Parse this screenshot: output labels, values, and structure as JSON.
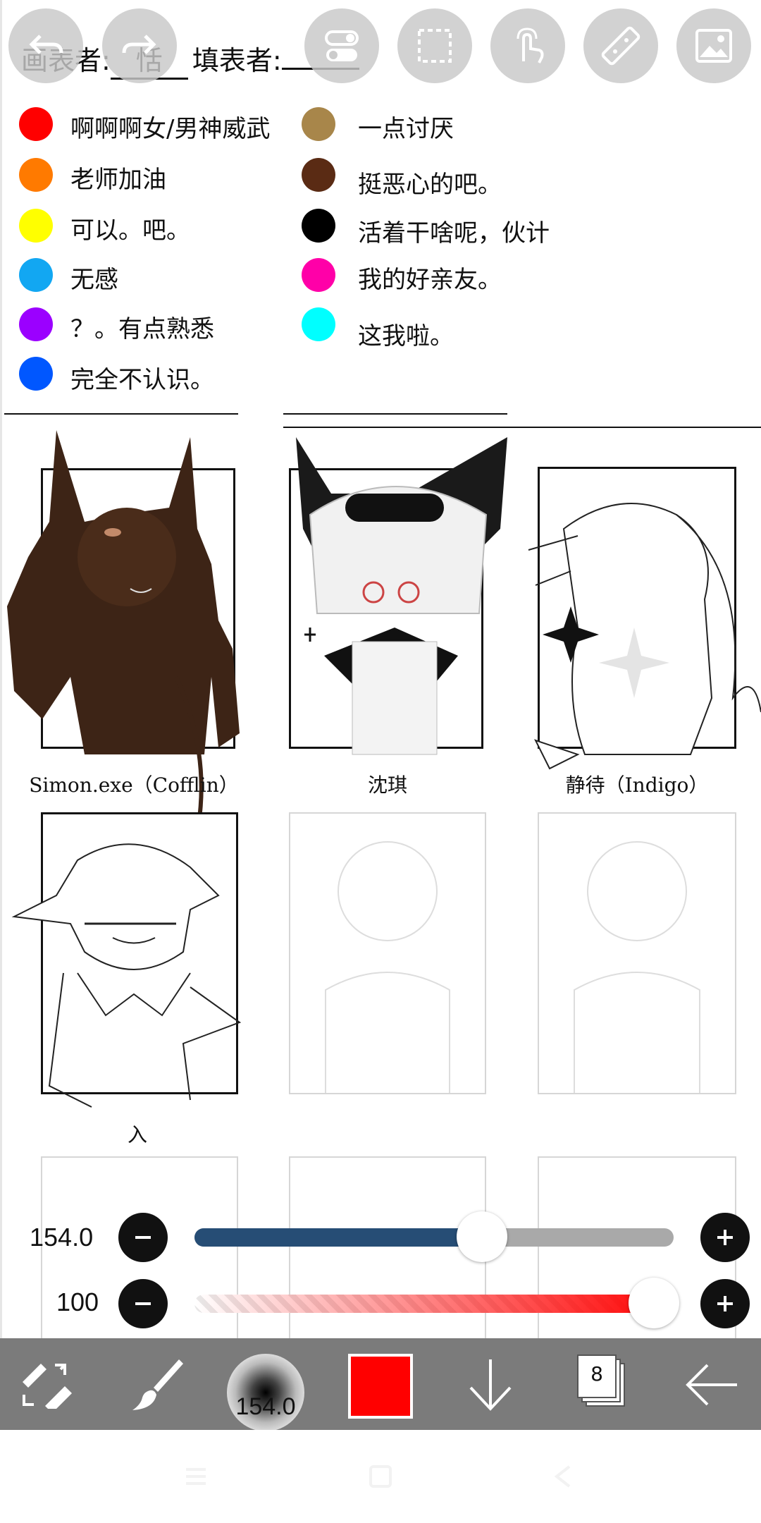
{
  "sheet": {
    "painter_label": "画表者:",
    "painter_value": "恬",
    "filler_label": "填表者:",
    "filler_value": ""
  },
  "legend": {
    "left": [
      {
        "color": "#ff0000",
        "label": "啊啊啊女/男神威武"
      },
      {
        "color": "#ff7a00",
        "label": "老师加油"
      },
      {
        "color": "#ffff00",
        "label": "可以。吧。"
      },
      {
        "color": "#12a7f2",
        "label": "无感"
      },
      {
        "color": "#9b00ff",
        "label": "？。有点熟悉"
      },
      {
        "color": "#0057ff",
        "label": "完全不认识。"
      }
    ],
    "right": [
      {
        "color": "#a8864a",
        "label": "一点讨厌"
      },
      {
        "color": "#5a2b14",
        "label": "挺恶心的吧。"
      },
      {
        "color": "#000000",
        "label": "活着干啥呢，伙计"
      },
      {
        "color": "#ff00a8",
        "label": "我的好亲友。"
      },
      {
        "color": "#00ffff",
        "label": "这我啦。"
      }
    ]
  },
  "characters": [
    {
      "caption": "Simon.exe（Cofflin）"
    },
    {
      "caption": "沈琪"
    },
    {
      "caption": "静待（Indigo）"
    },
    {
      "caption": "入"
    }
  ],
  "top_toolbar": {
    "icons": [
      "undo-icon",
      "redo-icon",
      "toggle-icon",
      "selection-icon",
      "gesture-icon",
      "ruler-icon",
      "image-icon"
    ]
  },
  "sliders": {
    "brush_size": {
      "value_text": "154.0",
      "fraction": 0.6
    },
    "opacity": {
      "value_text": "100",
      "fraction": 1.0
    }
  },
  "bottom_toolbar": {
    "brush_preview_size": "154.0",
    "current_color": "#ff0000",
    "layer_count": "8"
  }
}
